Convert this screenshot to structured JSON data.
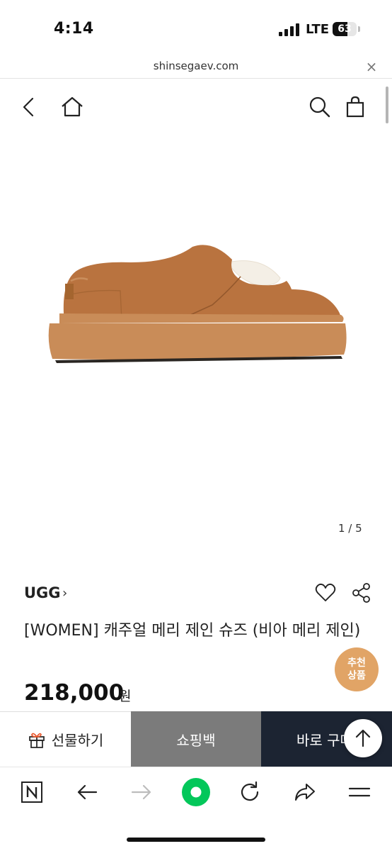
{
  "status_bar": {
    "time": "4:14",
    "network": "LTE",
    "battery_level": 63,
    "battery_text": "63"
  },
  "browser": {
    "url": "shinsegaev.com",
    "close_label": "×"
  },
  "header": {
    "icons": [
      "back-icon",
      "home-icon",
      "search-icon",
      "shopping-bag-icon"
    ]
  },
  "product": {
    "image_counter": "1 / 5",
    "brand": "UGG",
    "brand_chevron": "›",
    "name": "[WOMEN] 캐주얼 메리 제인 슈즈 (비아 메리 제인)",
    "price": "218,000",
    "price_unit": "원",
    "recommend_line1": "추천",
    "recommend_line2": "상품",
    "colors": {
      "suede": "#b9733f",
      "sole": "#c98c58",
      "fleece": "#f4efe6"
    }
  },
  "purchase_bar": {
    "gift_label": "선물하기",
    "cart_label": "쇼핑백",
    "buy_label": "바로 구매"
  },
  "browser_nav": {
    "icons": [
      "naver-icon",
      "back-arrow-icon",
      "forward-arrow-icon",
      "green-dot-icon",
      "reload-icon",
      "share-arrow-icon",
      "menu-icon"
    ],
    "accent": "#03c75a"
  }
}
